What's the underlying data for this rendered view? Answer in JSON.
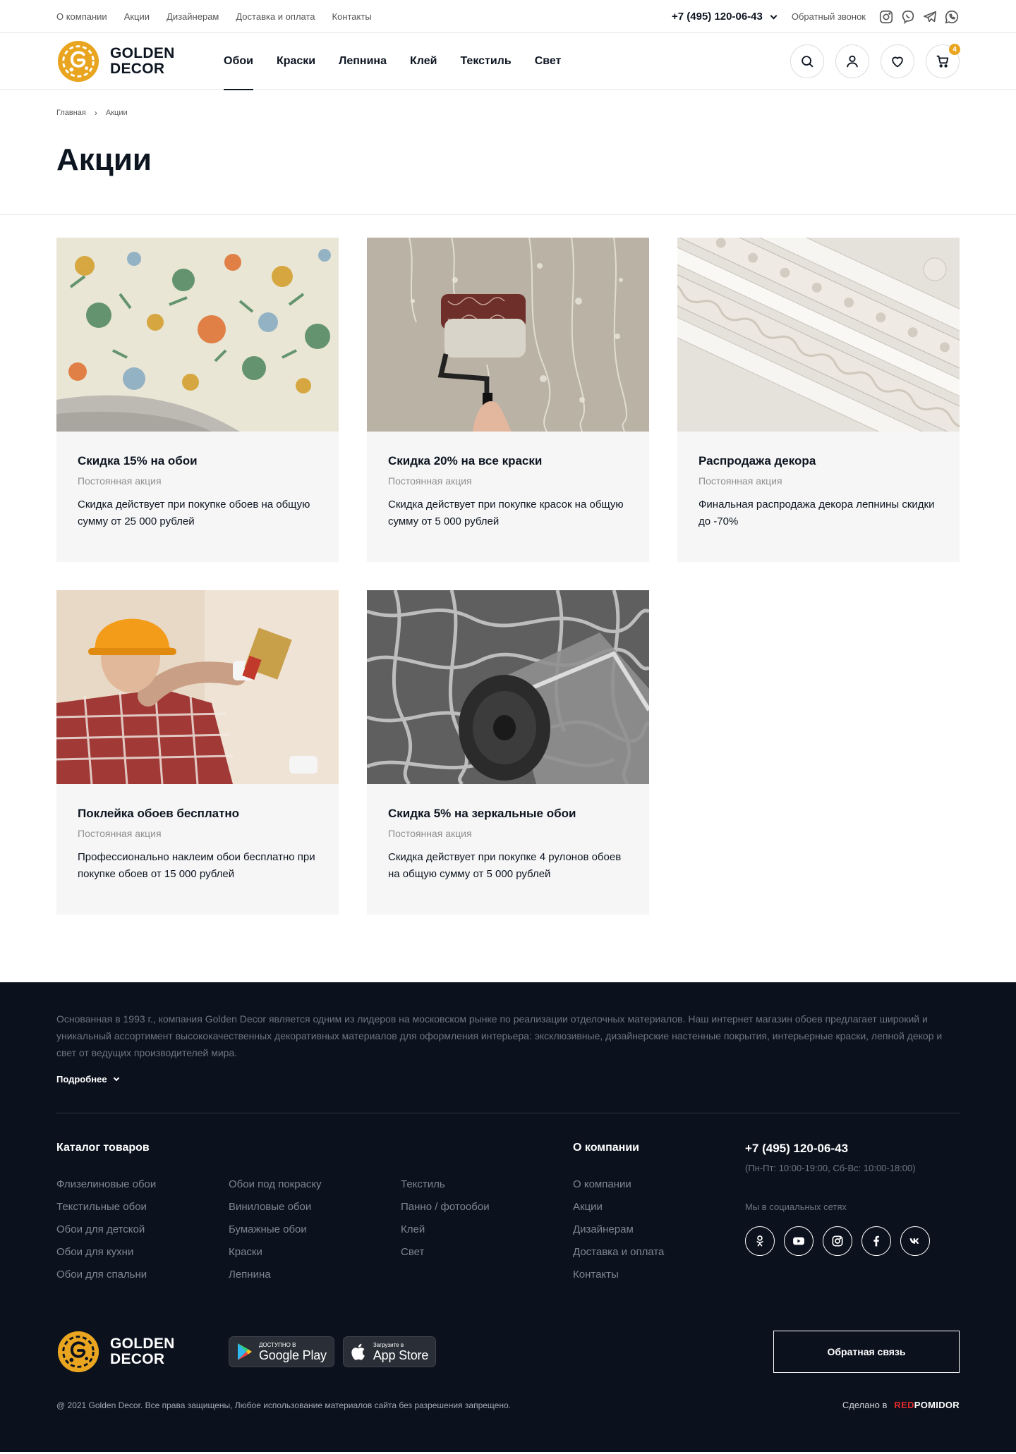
{
  "topbar": {
    "links": [
      "О компании",
      "Акции",
      "Дизайнерам",
      "Доставка и оплата",
      "Контакты"
    ],
    "phone": "+7 (495) 120-06-43",
    "callback": "Обратный звонок",
    "social_icons": [
      "instagram-icon",
      "viber-icon",
      "telegram-icon",
      "whatsapp-icon"
    ]
  },
  "header": {
    "logo_line1": "GOLDEN",
    "logo_line2": "DECOR",
    "nav": [
      "Обои",
      "Краски",
      "Лепнина",
      "Клей",
      "Текстиль",
      "Свет"
    ],
    "active_nav": "Обои",
    "icons": [
      "search-icon",
      "user-icon",
      "heart-icon",
      "cart-icon"
    ],
    "cart_count": "4",
    "accent_color": "#e9a520"
  },
  "breadcrumb": [
    "Главная",
    "Акции"
  ],
  "page_title": "Акции",
  "promos": [
    {
      "title": "Скидка 15% на обои",
      "kind": "Постоянная акция",
      "desc": "Скидка действует при покупке обоев на общую сумму от 25 000 рублей"
    },
    {
      "title": "Скидка 20% на все краски",
      "kind": "Постоянная акция",
      "desc": "Скидка действует при покупке красок на общую сумму от 5 000 рублей"
    },
    {
      "title": "Распродажа декора",
      "kind": "Постоянная акция",
      "desc": "Финальная распродажа декора лепнины скидки до -70%"
    },
    {
      "title": "Поклейка обоев бесплатно",
      "kind": "Постоянная акция",
      "desc": "Профессионально наклеим обои бесплатно при покупке обоев от 15 000 рублей"
    },
    {
      "title": "Скидка 5% на зеркальные обои",
      "kind": "Постоянная акция",
      "desc": "Скидка действует при покупке 4 рулонов обоев на общую сумму от 5 000 рублей"
    }
  ],
  "footer": {
    "about": "Основанная в 1993 г., компания Golden Decor является одним из лидеров на московском рынке по реализации отделочных материалов. Наш интернет магазин обоев предлагает широкий и уникальный ассортимент высококачественных декоративных материалов для оформления интерьера: эксклюзивные, дизайнерские настенные покрытия, интерьерные краски, лепной декор и свет от ведущих производителей мира.",
    "more": "Подробнее",
    "catalog_title": "Каталог товаров",
    "catalog_cols": [
      [
        "Флизелиновые обои",
        "Текстильные обои",
        "Обои для детской",
        "Обои для кухни",
        "Обои для спальни"
      ],
      [
        "Обои под покраску",
        "Виниловые обои",
        "Бумажные обои",
        "Краски",
        "Лепнина"
      ],
      [
        "Текстиль",
        "Панно / фотообои",
        "Клей",
        "Свет"
      ]
    ],
    "company_title": "О компании",
    "company_links": [
      "О компании",
      "Акции",
      "Дизайнерам",
      "Доставка и оплата",
      "Контакты"
    ],
    "phone": "+7 (495) 120-06-43",
    "hours": "(Пн-Пт: 10:00-19:00, Сб-Вс: 10:00-18:00)",
    "social_label": "Мы в социальных сетях",
    "social_icons": [
      "odnoklassniki-icon",
      "youtube-icon",
      "instagram-icon",
      "facebook-icon",
      "vk-icon"
    ],
    "google_small": "ДОСТУПНО В",
    "google_big": "Google Play",
    "apple_small": "Загрузите в",
    "apple_big": "App Store",
    "feedback": "Обратная связь",
    "copyright": "@ 2021 Golden Decor. Все права защищены, Любое использование материалов сайта без разрешения запрещено.",
    "made_in": "Сделано в",
    "made_brand_1": "RED",
    "made_brand_2": "POMIDOR"
  }
}
